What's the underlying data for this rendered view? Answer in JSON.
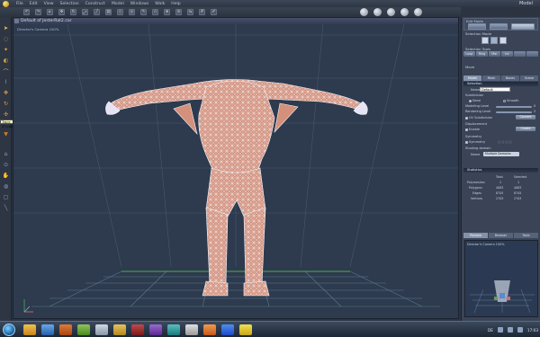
{
  "menubar": {
    "items": [
      "File",
      "Edit",
      "View",
      "Selection",
      "Construct",
      "Model",
      "Windows",
      "Walk",
      "Help"
    ],
    "mode_label": "Model"
  },
  "viewport": {
    "title": "Default of JesterRat2.car",
    "camera_label": "Director's Camera 100%"
  },
  "tooltip": "Trace (F) (W)",
  "panel": {
    "edit_mode_label": "Edit Mode",
    "selection_mode_label": "Selection Mode",
    "selection_tools_label": "Selection Tools",
    "selection_tools": [
      "Loop",
      "Ring",
      "Mar",
      "Int",
      "",
      ""
    ],
    "move_label": "Move",
    "tabs": [
      "Model",
      "Mesh",
      "Bones",
      "Scene"
    ],
    "selection_header": "Selection",
    "name_label": "Name",
    "name_value": "Default",
    "subdivision_label": "Subdivision",
    "none_label": "None",
    "smooth_label": "Smooth",
    "modeling_level_label": "Modeling Level",
    "modeling_level_value": "0",
    "rendering_level_label": "Rendering Level",
    "rendering_level_value": "2",
    "uv_subdivision_label": "UV Subdivision",
    "convert_label": "Convert",
    "displacement_label": "Displacement",
    "enable_label": "Enable",
    "create_label": "Create",
    "symmetry_label": "Symmetry",
    "symmetry_check_label": "Symmetry",
    "shading_domain_label": "Shading domain",
    "shading_name_label": "Name",
    "shading_name_value": "Multiple Domains",
    "statistics_header": "Statistics",
    "stats_cols": [
      "Total",
      "Selected"
    ],
    "stats_rows": [
      {
        "label": "Polymeshes",
        "total": "1",
        "selected": "1"
      },
      {
        "label": "Polygons",
        "total": "4083",
        "selected": "4083"
      },
      {
        "label": "Edges",
        "total": "8745",
        "selected": "8745"
      },
      {
        "label": "Vertices",
        "total": "2703",
        "selected": "2703"
      }
    ]
  },
  "preview": {
    "tabs": [
      "Preview",
      "Browser",
      "Tools"
    ],
    "camera_label": "Director's Camera 100%"
  },
  "taskbar": {
    "lang": "DE",
    "clock": "17:03"
  },
  "colors": {
    "mesh_fill": "#d4907a",
    "mesh_wire": "#e8eefc",
    "grid": "#4e6a82",
    "axis_green": "#4caf50"
  }
}
